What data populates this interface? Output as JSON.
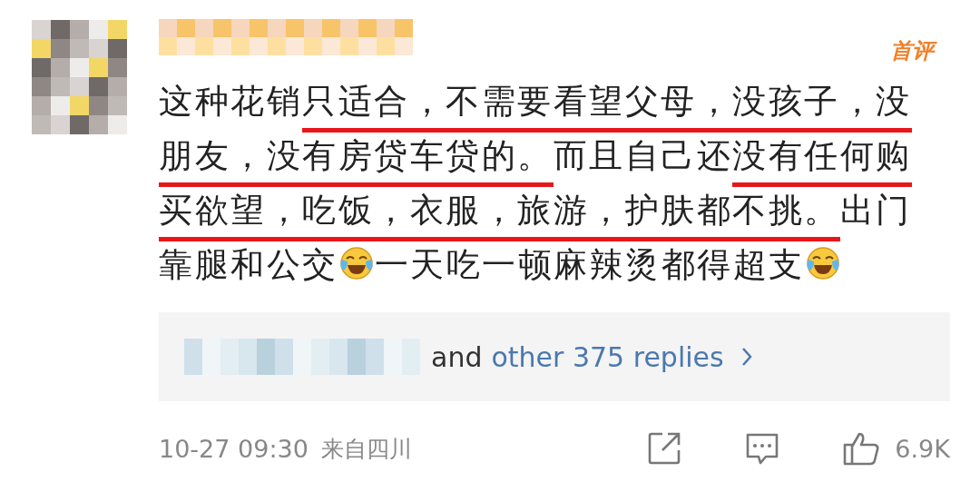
{
  "comment": {
    "username": {
      "kind": "mosaic"
    },
    "badge": "首评",
    "segments": [
      {
        "kind": "text",
        "text": "这种花销",
        "underlined": false
      },
      {
        "kind": "text",
        "text": "只适合，不需要看望父母，没孩子，没朋友，没有房贷车贷的。",
        "underlined": true
      },
      {
        "kind": "text",
        "text": "而且自己还",
        "underlined": false
      },
      {
        "kind": "text",
        "text": "没有任何购买欲望，吃饭，衣服，旅游，护肤都不挑。",
        "underlined": true
      },
      {
        "kind": "text",
        "text": "出门靠腿和公交",
        "underlined": false
      },
      {
        "kind": "emoji"
      },
      {
        "kind": "text",
        "text": "一天吃一顿麻辣烫都得超支",
        "underlined": false
      },
      {
        "kind": "emoji"
      }
    ],
    "replies": {
      "author": {
        "kind": "mosaic"
      },
      "connector": "and",
      "link": "other 375 replies"
    },
    "footer": {
      "time": "10-27 09:30",
      "location": "来自四川",
      "likes": "6.9K"
    }
  }
}
